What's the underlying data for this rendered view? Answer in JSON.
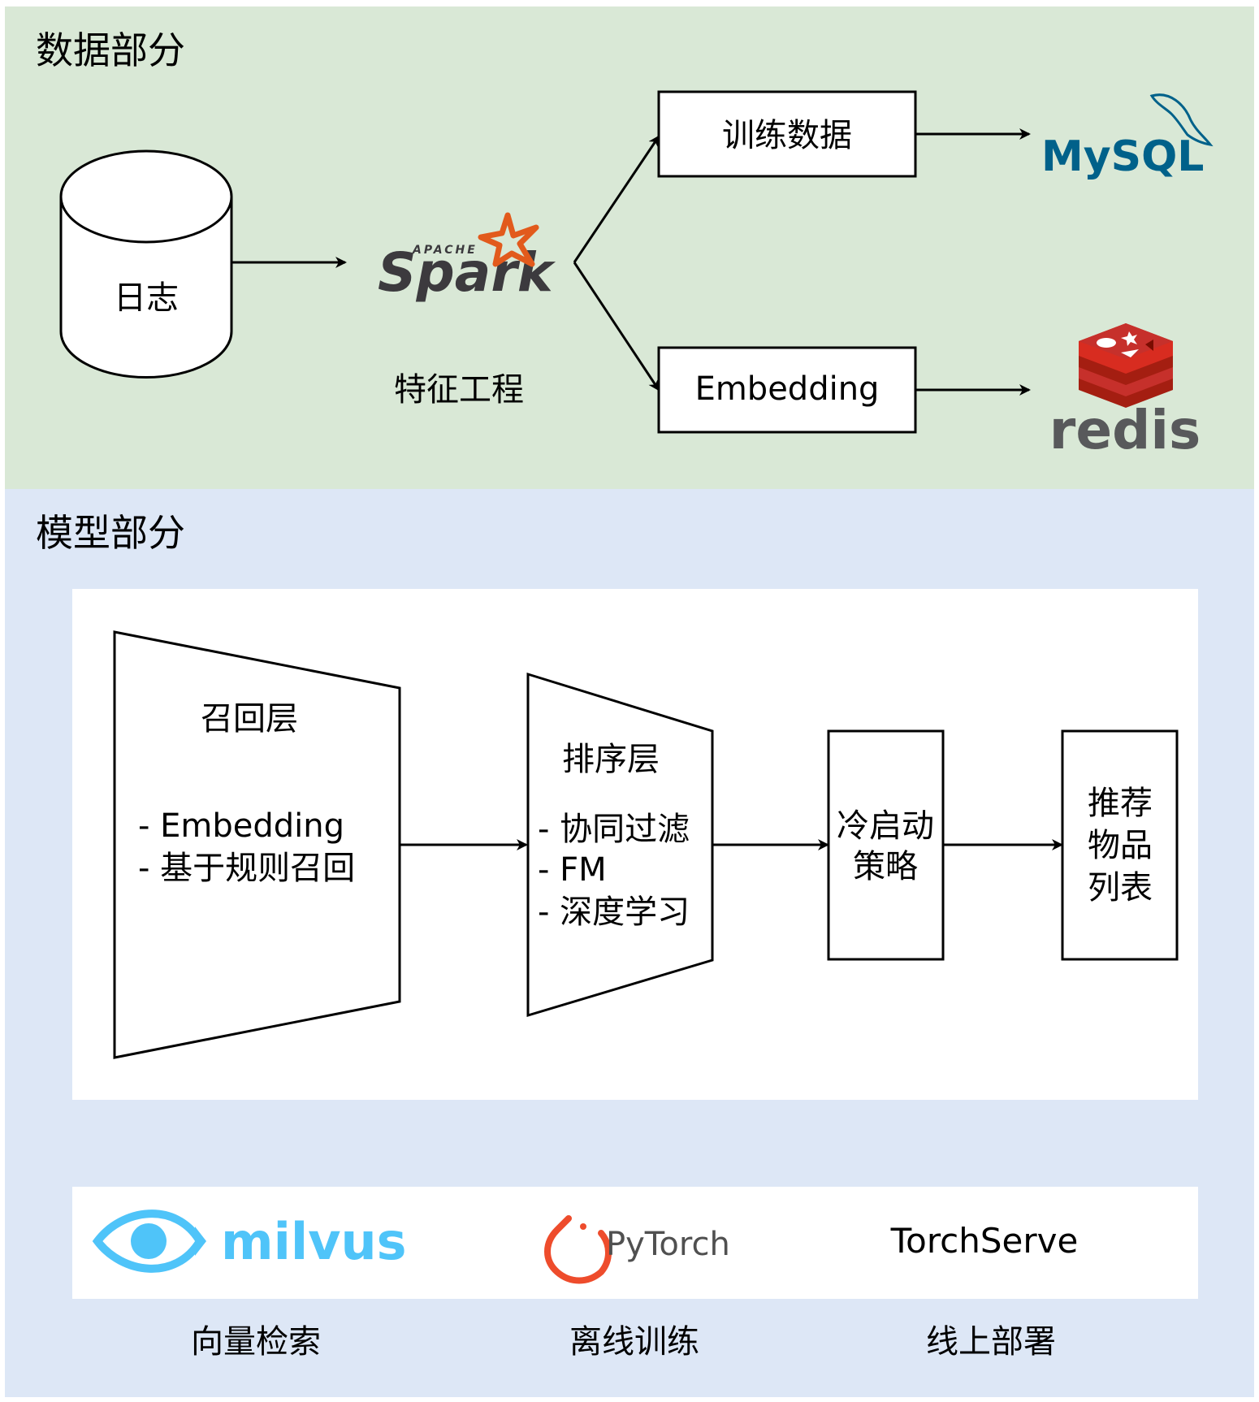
{
  "colors": {
    "data_section_bg": "#d9e8d6",
    "model_section_bg": "#dde7f6",
    "panel_bg": "#ffffff",
    "stroke": "#000000",
    "spark_orange": "#e25a1c",
    "spark_gray": "#3c3a3e",
    "mysql_blue": "#00618a",
    "mysql_orange": "#e48e00",
    "redis_red": "#c6302b",
    "redis_gray": "#58595b",
    "milvus_blue": "#4fc4f9",
    "pytorch_orange": "#ee4c2c",
    "pytorch_gray": "#505050"
  },
  "data_section": {
    "title": "数据部分",
    "log_store": "日志",
    "feature_engineering": "特征工程",
    "training_data": "训练数据",
    "embedding": "Embedding",
    "logos": {
      "spark_small": "APACHE",
      "spark_big": "Spark",
      "mysql": "MySQL",
      "redis": "redis"
    }
  },
  "model_section": {
    "title": "模型部分",
    "recall_layer": {
      "title": "召回层",
      "items": [
        "- Embedding",
        "- 基于规则召回"
      ]
    },
    "ranking_layer": {
      "title": "排序层",
      "items": [
        "- 协同过滤",
        "- FM",
        "- 深度学习"
      ]
    },
    "cold_start": [
      "冷启动",
      "策略"
    ],
    "recommend_list": [
      "推荐",
      "物品",
      "列表"
    ],
    "tools": {
      "milvus": "milvus",
      "pytorch": "PyTorch",
      "torchserve": "TorchServe"
    },
    "tool_captions": {
      "vector_search": "向量检索",
      "offline_training": "离线训练",
      "online_deployment": "线上部署"
    }
  }
}
